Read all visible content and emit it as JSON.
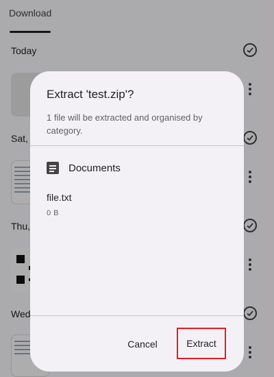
{
  "tabs": {
    "download_label": "Download"
  },
  "sections": [
    {
      "label": "Today"
    },
    {
      "label": "Sat,"
    },
    {
      "label": "Thu,"
    },
    {
      "label": "Wed"
    }
  ],
  "dialog": {
    "title": "Extract 'test.zip'?",
    "description": "1 file will be extracted and organised by category.",
    "category": {
      "icon": "document-icon",
      "label": "Documents"
    },
    "file": {
      "name": "file.txt",
      "size": "0 B"
    },
    "buttons": {
      "cancel": "Cancel",
      "extract": "Extract"
    }
  },
  "colors": {
    "highlight": "#e8191f",
    "dialog_bg": "#f3f1f6"
  }
}
